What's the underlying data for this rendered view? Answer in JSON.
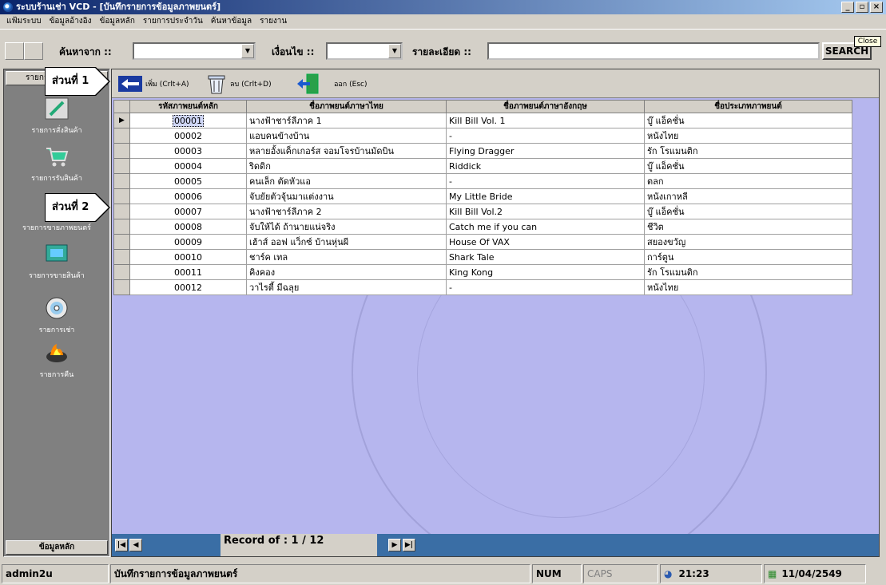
{
  "window": {
    "title": "ระบบร้านเช่า VCD - [บันทึกรายการข้อมูลภาพยนตร์]",
    "buttons": [
      "_",
      "▫",
      "×"
    ]
  },
  "menu": [
    "แฟ้มระบบ",
    "ข้อมูลอ้างอิง",
    "ข้อมูลหลัก",
    "รายการประจำวัน",
    "ค้นหาข้อมูล",
    "รายงาน"
  ],
  "search": {
    "from_label": "ค้นหาจาก ::",
    "condition_label": "เงื่อนไข ::",
    "detail_label": "รายละเอียด ::",
    "search_button": "SEARCH",
    "close_tooltip": "Close"
  },
  "sidebar": {
    "tab_label": "รายการ",
    "items": [
      {
        "label": "รายการสั่งสินค้า",
        "icon": "pen-icon"
      },
      {
        "label": "รายการรับสินค้า",
        "icon": "cart-icon"
      },
      {
        "label": "รายการขายภาพยนตร์",
        "icon": "film-icon"
      },
      {
        "label": "รายการขายสินค้า",
        "icon": "money-icon"
      },
      {
        "label": "รายการเช่า",
        "icon": "disc-icon"
      },
      {
        "label": "รายการคืน",
        "icon": "fire-icon"
      }
    ],
    "bottom_label": "ข้อมูลหลัก"
  },
  "callouts": {
    "part1": "ส่วนที่ 1",
    "part2": "ส่วนที่ 2"
  },
  "toolbar": {
    "add": "เพิ่ม (Crlt+A)",
    "delete": "ลบ (Crlt+D)",
    "exit": "ออก (Esc)"
  },
  "table": {
    "headers": [
      "รหัสภาพยนต์หลัก",
      "ชื่อภาพยนต์ภาษาไทย",
      "ชื่อภาพยนต์ภาษาอังกฤษ",
      "ชื่อประเภทภาพยนต์"
    ],
    "rows": [
      {
        "code": "00001",
        "thai": "นางฟ้าชาร์ลีภาค 1",
        "eng": "Kill Bill Vol. 1",
        "type": "บู๊ แอ็คชั่น"
      },
      {
        "code": "00002",
        "thai": "แอบคนข้างบ้าน",
        "eng": "-",
        "type": "หนังไทย"
      },
      {
        "code": "00003",
        "thai": "หลายอั้งแค็กเกอร์ส จอมโจรบ้านมัดบิน",
        "eng": "Flying Dragger",
        "type": "รัก โรแมนติก"
      },
      {
        "code": "00004",
        "thai": "ริดดิก",
        "eng": "Riddick",
        "type": "บู๊ แอ็คชั่น"
      },
      {
        "code": "00005",
        "thai": "คนเล็ก ตัดหัวแอ",
        "eng": "-",
        "type": "ตลก"
      },
      {
        "code": "00006",
        "thai": "จับยัยตัวจุ้นมาแต่งงาน",
        "eng": "My Little Bride",
        "type": "หนังเกาหลี"
      },
      {
        "code": "00007",
        "thai": "นางฟ้าชาร์ลีภาค 2",
        "eng": "Kill Bill Vol.2",
        "type": "บู๊ แอ็คชั่น"
      },
      {
        "code": "00008",
        "thai": "จับให้ได้ ถ้านายแน่จริง",
        "eng": "Catch me if you can",
        "type": "ชีวิต"
      },
      {
        "code": "00009",
        "thai": "เฮ้าส์ ออฟ แว็กซ์ บ้านหุ่นผี",
        "eng": "House Of VAX",
        "type": "สยองขวัญ"
      },
      {
        "code": "00010",
        "thai": "ชาร์ค เทล",
        "eng": "Shark Tale",
        "type": "การ์ตูน"
      },
      {
        "code": "00011",
        "thai": "คิงคอง",
        "eng": "King Kong",
        "type": "รัก โรแมนติก"
      },
      {
        "code": "00012",
        "thai": "วาไรตี้ มีฉลุย",
        "eng": "-",
        "type": "หนังไทย"
      }
    ]
  },
  "navigation": {
    "record_label": "Record of :  1 / 12"
  },
  "status": {
    "user": "admin2u",
    "form": "บันทึกรายการข้อมูลภาพยนตร์",
    "num": "NUM",
    "caps": "CAPS",
    "time": "21:23",
    "date": "11/04/2549"
  }
}
